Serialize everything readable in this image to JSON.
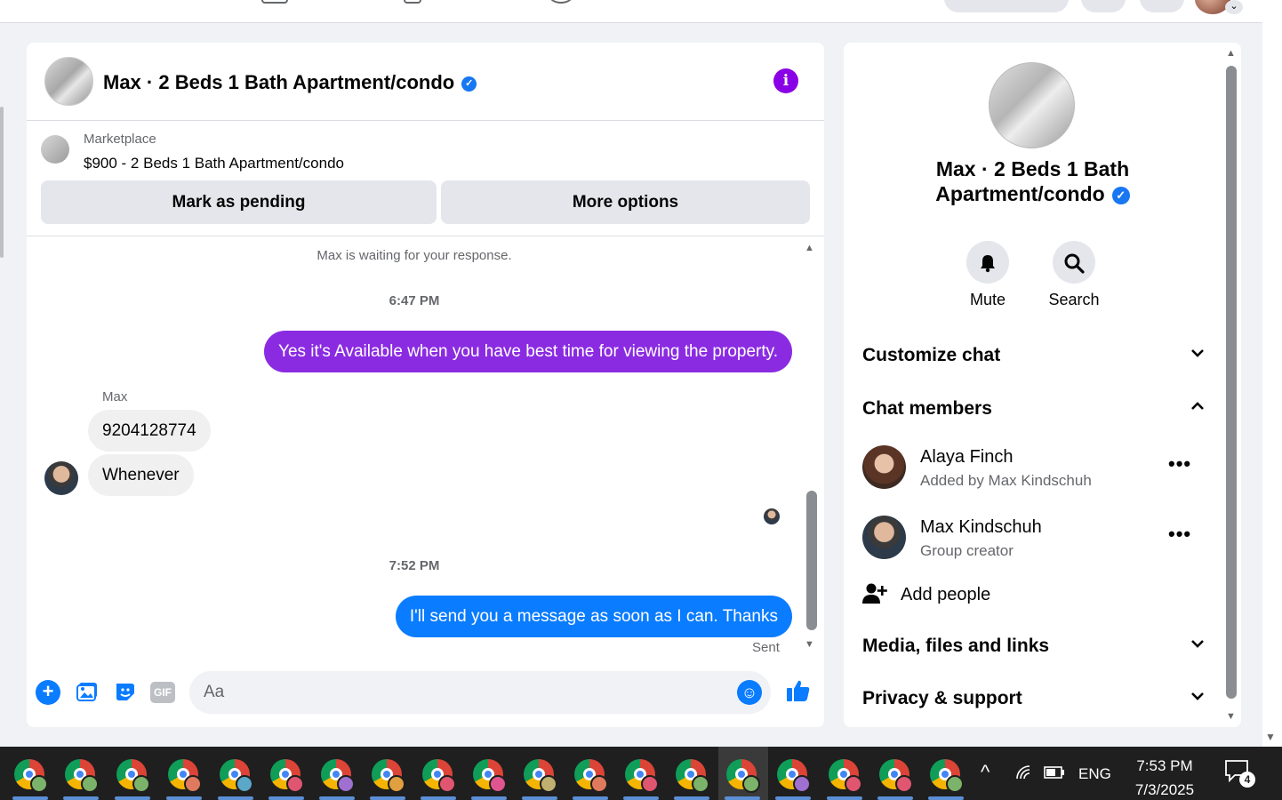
{
  "chat": {
    "title": "Max · 2 Beds 1 Bath Apartment/condo",
    "info_icon": "info-icon",
    "listing": {
      "kind": "Marketplace",
      "name": "$900 - 2 Beds 1 Bath Apartment/condo",
      "mark_pending": "Mark as pending",
      "more_options": "More options"
    },
    "messages": {
      "system": "Max is waiting for your response.",
      "time1": "6:47 PM",
      "out1": "Yes it's Available when you have best time for viewing the property.",
      "out1_color": "#8a2be2",
      "sender": "Max",
      "in1": "9204128774",
      "in2": "Whenever",
      "time2": "7:52 PM",
      "out2": "I'll send you a message as soon as I can. Thanks",
      "out2_color": "#0a7cff",
      "status": "Sent"
    },
    "composer": {
      "placeholder": "Aa",
      "gif_label": "GIF",
      "icons": [
        "plus-icon",
        "photo-icon",
        "sticker-icon",
        "gif-icon",
        "emoji-icon",
        "like-icon"
      ]
    }
  },
  "side": {
    "name": "Max · 2 Beds 1 Bath Apartment/condo",
    "actions": [
      {
        "label": "Mute",
        "icon": "bell-icon"
      },
      {
        "label": "Search",
        "icon": "search-icon"
      }
    ],
    "sections": {
      "customize": "Customize chat",
      "members": "Chat members",
      "media": "Media, files and links",
      "privacy": "Privacy & support"
    },
    "members": [
      {
        "name": "Alaya Finch",
        "sub": "Added by Max Kindschuh"
      },
      {
        "name": "Max Kindschuh",
        "sub": "Group creator"
      }
    ],
    "add_people": "Add people"
  },
  "taskbar": {
    "apps": [
      {
        "badge_color": "#7cb36a"
      },
      {
        "badge_color": "#7cb36a"
      },
      {
        "badge_color": "#7cb36a"
      },
      {
        "badge_color": "#e07a5f"
      },
      {
        "badge_color": "#5aa7c8"
      },
      {
        "badge_color": "#e05570"
      },
      {
        "badge_color": "#a070d0"
      },
      {
        "badge_color": "#e0a040"
      },
      {
        "badge_color": "#e05570"
      },
      {
        "badge_color": "#e05590"
      },
      {
        "badge_color": "#c0b070"
      },
      {
        "badge_color": "#e07a5f"
      },
      {
        "badge_color": "#e05570"
      },
      {
        "badge_color": "#7cb36a"
      },
      {
        "badge_color": "#7cb36a"
      },
      {
        "badge_color": "#a070d0"
      },
      {
        "badge_color": "#e05570"
      },
      {
        "badge_color": "#e05570"
      },
      {
        "badge_color": "#7cb36a"
      }
    ],
    "language": "ENG",
    "time": "7:53 PM",
    "date": "7/3/2025",
    "notifications": "4"
  }
}
